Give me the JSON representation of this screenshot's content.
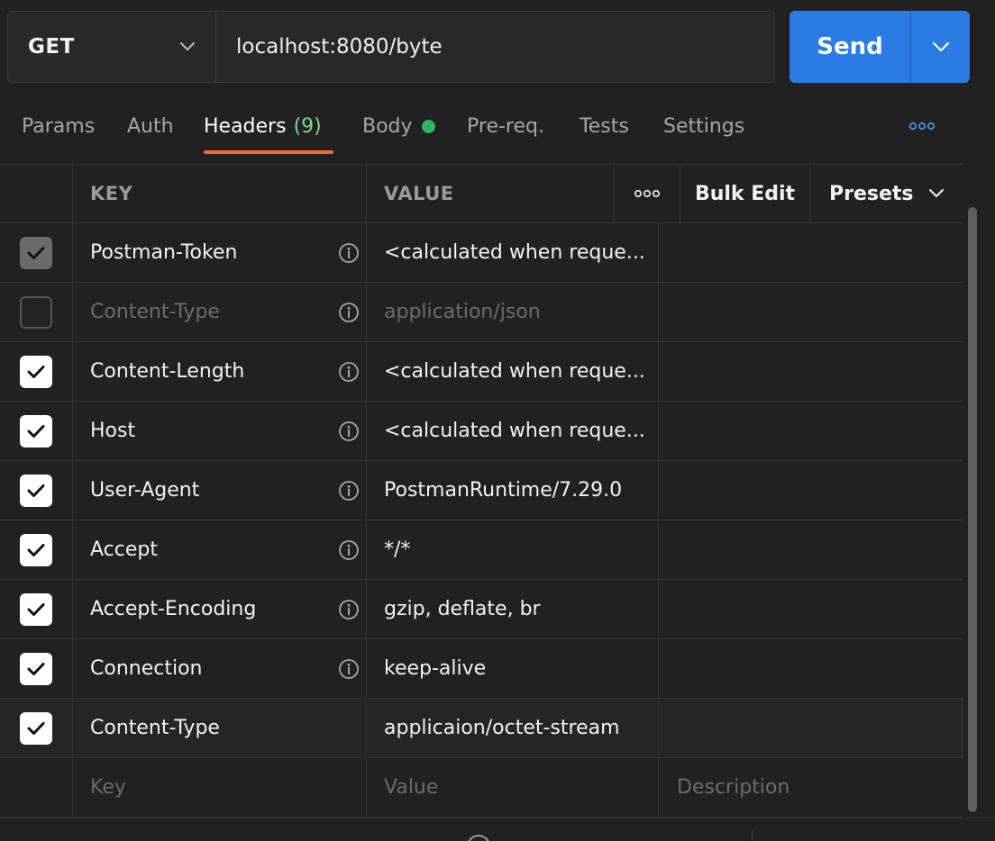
{
  "request": {
    "method": "GET",
    "url": "localhost:8080/byte",
    "send_label": "Send"
  },
  "tabs": {
    "params": "Params",
    "auth": "Auth",
    "headers": "Headers",
    "headers_count": "(9)",
    "body": "Body",
    "prereq": "Pre-req.",
    "tests": "Tests",
    "settings": "Settings"
  },
  "table": {
    "key_header": "KEY",
    "value_header": "VALUE",
    "bulk_edit": "Bulk Edit",
    "presets": "Presets",
    "rows": [
      {
        "key": "Postman-Token",
        "value": "<calculated when reque...",
        "state": "locked"
      },
      {
        "key": "Content-Type",
        "value": "application/json",
        "state": "off"
      },
      {
        "key": "Content-Length",
        "value": "<calculated when reque...",
        "state": "on"
      },
      {
        "key": "Host",
        "value": "<calculated when reque...",
        "state": "on"
      },
      {
        "key": "User-Agent",
        "value": "PostmanRuntime/7.29.0",
        "state": "on"
      },
      {
        "key": "Accept",
        "value": "*/*",
        "state": "on"
      },
      {
        "key": "Accept-Encoding",
        "value": "gzip, deflate, br",
        "state": "on"
      },
      {
        "key": "Connection",
        "value": "keep-alive",
        "state": "on"
      },
      {
        "key": "Content-Type",
        "value": "applicaion/octet-stream",
        "state": "on"
      }
    ],
    "new_row": {
      "key_placeholder": "Key",
      "value_placeholder": "Value",
      "description_placeholder": "Description"
    }
  },
  "colors": {
    "background": "#212121",
    "send_button": "#2a7be4",
    "active_tab_underline": "#f26b3a",
    "headers_count": "#7bd88f",
    "body_dot": "#2fb461"
  },
  "icons": [
    "chevron-down-icon",
    "more-horizontal-icon",
    "info-icon",
    "checkmark-icon",
    "globe-icon"
  ]
}
